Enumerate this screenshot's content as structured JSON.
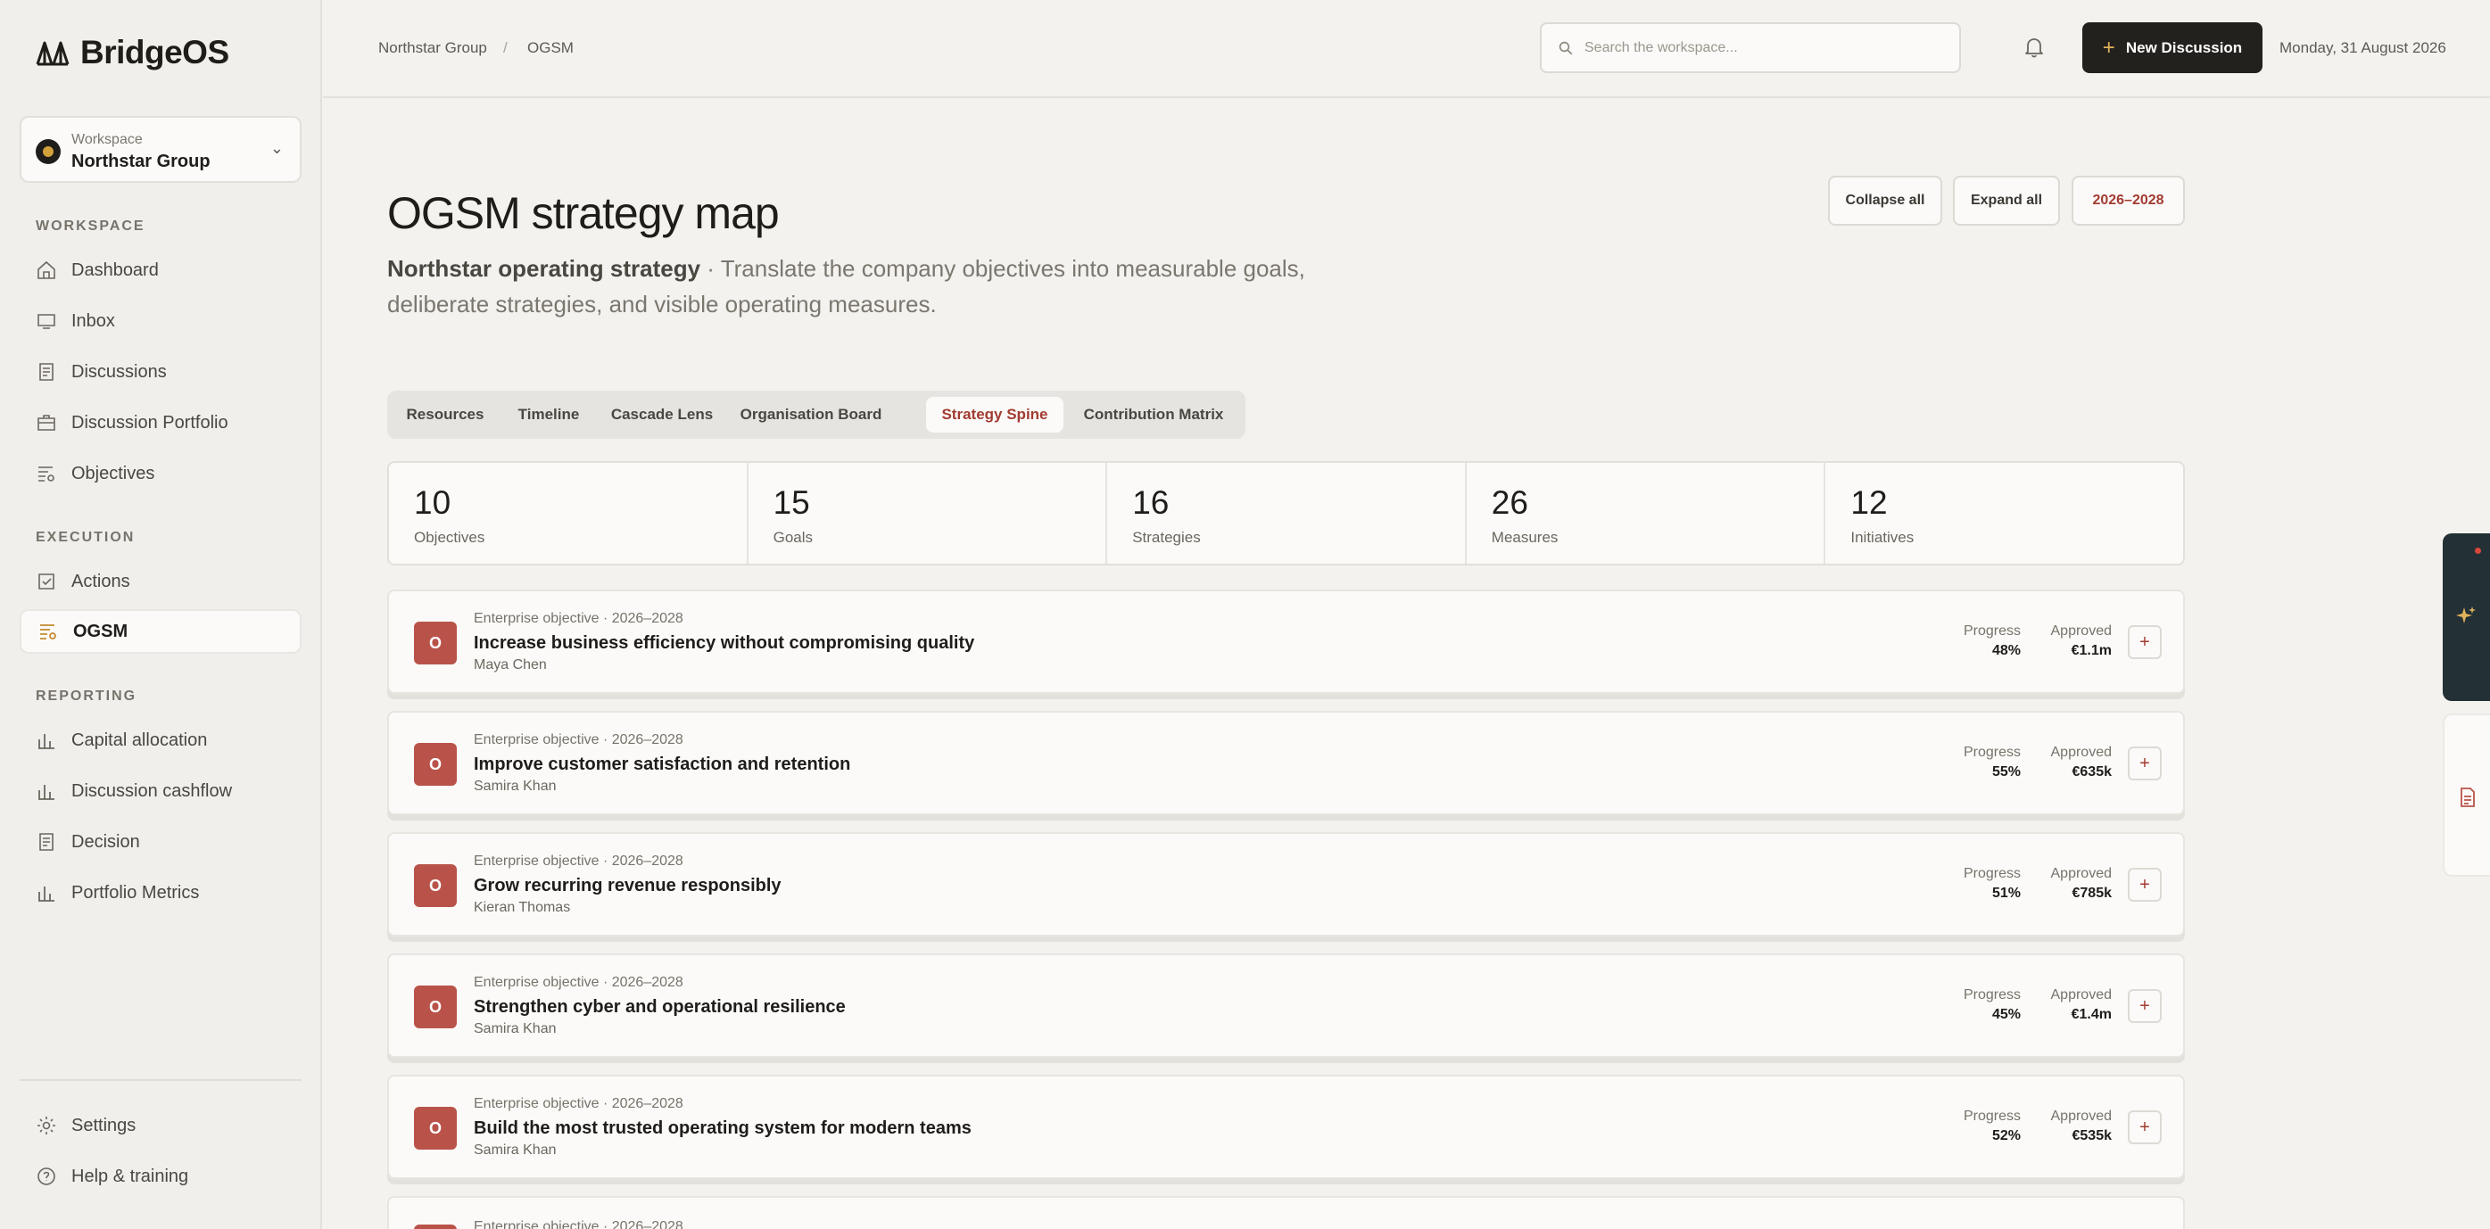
{
  "app": {
    "name": "BridgeOS"
  },
  "workspace": {
    "label": "Workspace",
    "name": "Northstar Group"
  },
  "sidebar": {
    "sections": [
      {
        "label": "WORKSPACE",
        "items": [
          {
            "label": "Dashboard",
            "icon": "home-icon"
          },
          {
            "label": "Inbox",
            "icon": "inbox-icon"
          },
          {
            "label": "Discussions",
            "icon": "document-icon"
          },
          {
            "label": "Discussion Portfolio",
            "icon": "briefcase-icon"
          },
          {
            "label": "Objectives",
            "icon": "objectives-icon"
          }
        ]
      },
      {
        "label": "EXECUTION",
        "items": [
          {
            "label": "Actions",
            "icon": "checkbox-icon"
          },
          {
            "label": "OGSM",
            "icon": "ogsm-icon",
            "active": true
          }
        ]
      },
      {
        "label": "REPORTING",
        "items": [
          {
            "label": "Capital allocation",
            "icon": "bar-chart-icon"
          },
          {
            "label": "Discussion cashflow",
            "icon": "bar-chart-icon"
          },
          {
            "label": "Decision",
            "icon": "document-icon"
          },
          {
            "label": "Portfolio Metrics",
            "icon": "bar-chart-icon"
          }
        ]
      }
    ],
    "footer": [
      {
        "label": "Settings",
        "icon": "gear-icon"
      },
      {
        "label": "Help & training",
        "icon": "help-icon"
      }
    ]
  },
  "topbar": {
    "breadcrumb": [
      "Northstar Group",
      "/",
      "OGSM"
    ],
    "search_placeholder": "Search the workspace...",
    "new_button": "New Discussion",
    "date": "Monday, 31 August 2026"
  },
  "header": {
    "title": "OGSM strategy map",
    "subtitle_strong": "Northstar operating strategy",
    "subtitle_rest": " · Translate the company objectives into measurable goals, deliberate strategies, and visible operating measures.",
    "buttons": {
      "collapse": "Collapse all",
      "expand": "Expand all",
      "period": "2026–2028"
    }
  },
  "tabs": [
    "Resources",
    "Timeline",
    "Cascade Lens",
    "Organisation Board",
    "Strategy Spine",
    "Contribution Matrix"
  ],
  "active_tab": "Strategy Spine",
  "stats": [
    {
      "value": "10",
      "label": "Objectives"
    },
    {
      "value": "15",
      "label": "Goals"
    },
    {
      "value": "16",
      "label": "Strategies"
    },
    {
      "value": "26",
      "label": "Measures"
    },
    {
      "value": "12",
      "label": "Initiatives"
    }
  ],
  "objectives": [
    {
      "badge": "O",
      "meta": "Enterprise objective · 2026–2028",
      "title": "Increase business efficiency without compromising quality",
      "owner": "Maya Chen",
      "progress_label": "Progress",
      "progress": "48%",
      "approved_label": "Approved",
      "approved": "€1.1m"
    },
    {
      "badge": "O",
      "meta": "Enterprise objective · 2026–2028",
      "title": "Improve customer satisfaction and retention",
      "owner": "Samira Khan",
      "progress_label": "Progress",
      "progress": "55%",
      "approved_label": "Approved",
      "approved": "€635k"
    },
    {
      "badge": "O",
      "meta": "Enterprise objective · 2026–2028",
      "title": "Grow recurring revenue responsibly",
      "owner": "Kieran Thomas",
      "progress_label": "Progress",
      "progress": "51%",
      "approved_label": "Approved",
      "approved": "€785k"
    },
    {
      "badge": "O",
      "meta": "Enterprise objective · 2026–2028",
      "title": "Strengthen cyber and operational resilience",
      "owner": "Samira Khan",
      "progress_label": "Progress",
      "progress": "45%",
      "approved_label": "Approved",
      "approved": "€1.4m"
    },
    {
      "badge": "O",
      "meta": "Enterprise objective · 2026–2028",
      "title": "Build the most trusted operating system for modern teams",
      "owner": "Samira Khan",
      "progress_label": "Progress",
      "progress": "52%",
      "approved_label": "Approved",
      "approved": "€535k"
    },
    {
      "badge": "O",
      "meta": "Enterprise objective · 2026–2028"
    }
  ],
  "colors": {
    "accent": "#a23b32",
    "badge": "#b9534a",
    "dark": "#23211e",
    "gold": "#d2a13c"
  }
}
